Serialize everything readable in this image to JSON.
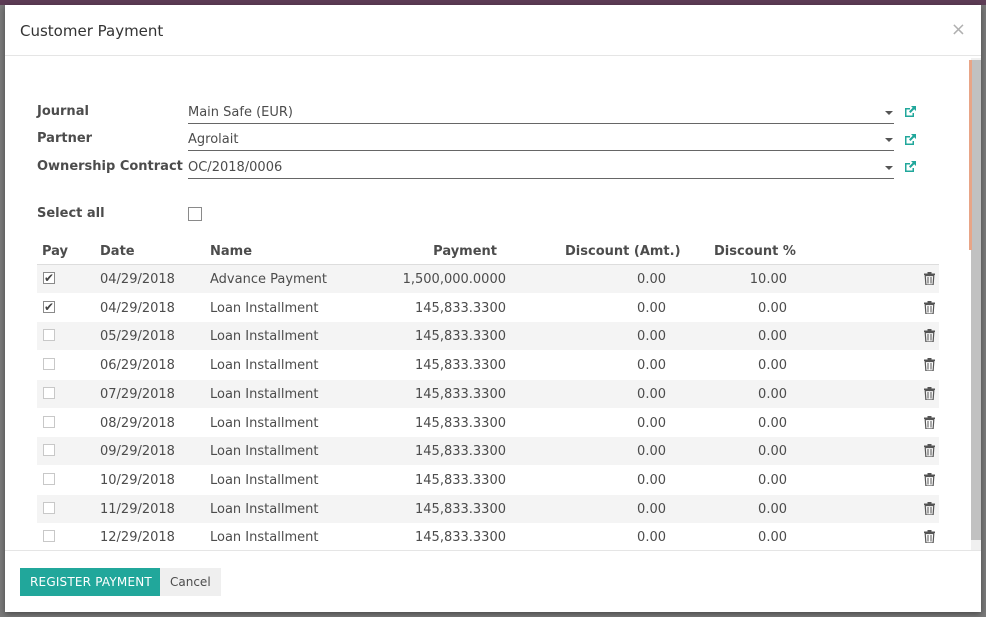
{
  "dialog": {
    "title": "Customer Payment"
  },
  "form": {
    "journal": {
      "label": "Journal",
      "value": "Main Safe (EUR)"
    },
    "partner": {
      "label": "Partner",
      "value": "Agrolait"
    },
    "contract": {
      "label": "Ownership Contract",
      "value": "OC/2018/0006"
    },
    "select_all": {
      "label": "Select all",
      "checked": false
    }
  },
  "table": {
    "headers": [
      "Pay",
      "Date",
      "Name",
      "Payment",
      "Discount (Amt.)",
      "Discount %"
    ],
    "rows": [
      {
        "pay": true,
        "date": "04/29/2018",
        "name": "Advance Payment",
        "payment": "1,500,000.0000",
        "discount_amt": "0.00",
        "discount_pct": "10.00"
      },
      {
        "pay": true,
        "date": "04/29/2018",
        "name": "Loan Installment",
        "payment": "145,833.3300",
        "discount_amt": "0.00",
        "discount_pct": "0.00"
      },
      {
        "pay": false,
        "date": "05/29/2018",
        "name": "Loan Installment",
        "payment": "145,833.3300",
        "discount_amt": "0.00",
        "discount_pct": "0.00"
      },
      {
        "pay": false,
        "date": "06/29/2018",
        "name": "Loan Installment",
        "payment": "145,833.3300",
        "discount_amt": "0.00",
        "discount_pct": "0.00"
      },
      {
        "pay": false,
        "date": "07/29/2018",
        "name": "Loan Installment",
        "payment": "145,833.3300",
        "discount_amt": "0.00",
        "discount_pct": "0.00"
      },
      {
        "pay": false,
        "date": "08/29/2018",
        "name": "Loan Installment",
        "payment": "145,833.3300",
        "discount_amt": "0.00",
        "discount_pct": "0.00"
      },
      {
        "pay": false,
        "date": "09/29/2018",
        "name": "Loan Installment",
        "payment": "145,833.3300",
        "discount_amt": "0.00",
        "discount_pct": "0.00"
      },
      {
        "pay": false,
        "date": "10/29/2018",
        "name": "Loan Installment",
        "payment": "145,833.3300",
        "discount_amt": "0.00",
        "discount_pct": "0.00"
      },
      {
        "pay": false,
        "date": "11/29/2018",
        "name": "Loan Installment",
        "payment": "145,833.3300",
        "discount_amt": "0.00",
        "discount_pct": "0.00"
      },
      {
        "pay": false,
        "date": "12/29/2018",
        "name": "Loan Installment",
        "payment": "145,833.3300",
        "discount_amt": "0.00",
        "discount_pct": "0.00"
      }
    ]
  },
  "footer": {
    "register_label": "REGISTER PAYMENT",
    "cancel_label": "Cancel"
  },
  "colors": {
    "primary": "#21a79b",
    "link": "#21a79b",
    "header_bar": "#5d3c55"
  },
  "icons": {
    "close": "close-icon",
    "external": "external-link-icon",
    "delete": "trash-icon",
    "caret": "caret-down-icon"
  }
}
